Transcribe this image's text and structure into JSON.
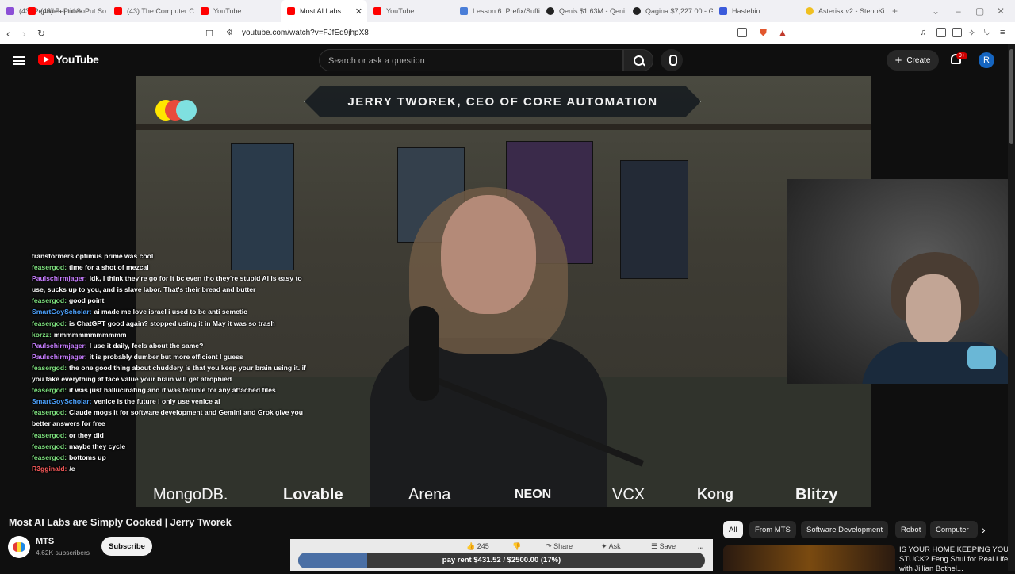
{
  "browser": {
    "tabs": [
      {
        "label": "(43) Peptides Put So...",
        "icon": "tab-favicon",
        "active": false
      },
      {
        "label": "(43) The Computer C...",
        "icon": "youtube-icon",
        "active": false
      },
      {
        "label": "YouTube",
        "icon": "youtube-icon",
        "active": false
      },
      {
        "label": "Most AI Labs",
        "icon": "youtube-icon",
        "active": true
      },
      {
        "label": "YouTube",
        "icon": "youtube-icon",
        "active": false
      },
      {
        "label": "Lesson 6: Prefix/Suffi...",
        "icon": "doc-icon",
        "active": false
      },
      {
        "label": "Qenis $1.63M - Qeni...",
        "icon": "github-icon",
        "active": false
      },
      {
        "label": "Qagina $7,227.00 - G...",
        "icon": "github-icon",
        "active": false
      },
      {
        "label": "Hastebin",
        "icon": "hastebin-icon",
        "active": false
      },
      {
        "label": "Asterisk v2 - StenoKi...",
        "icon": "asterisk-icon",
        "active": false
      }
    ],
    "url": "youtube.com/watch?v=FJfEq9jhpX8"
  },
  "youtube": {
    "logo_text": "YouTube",
    "search_placeholder": "Search or ask a question",
    "create_label": "Create",
    "notifications_badge": "9+",
    "account_initial": "R"
  },
  "video": {
    "overlay_title": "JERRY TWOREK, CEO OF CORE AUTOMATION",
    "sponsors": [
      "MongoDB.",
      "Lovable",
      "Arena",
      "NEON",
      "VCX",
      "Kong",
      "Blitzy"
    ]
  },
  "chat": [
    {
      "user": "",
      "text": "transformers optimus prime was cool",
      "color": "#ffffff"
    },
    {
      "user": "feasergod:",
      "text": "time for a shot of mezcal",
      "color": "#7ee07e"
    },
    {
      "user": "Paulschirmjager:",
      "text": "idk, I think they're go for it bc even tho they're stupid AI is easy to use, sucks up to you, and is slave labor. That's their bread and butter",
      "color": "#c77dff"
    },
    {
      "user": "feasergod:",
      "text": "good point",
      "color": "#7ee07e"
    },
    {
      "user": "SmartGoyScholar:",
      "text": "ai made me love israel i used to be anti semetic",
      "color": "#4da3ff"
    },
    {
      "user": "feasergod:",
      "text": "is ChatGPT good again? stopped using it in May it was so trash",
      "color": "#7ee07e"
    },
    {
      "user": "korzz:",
      "text": "mmmmmmmmmmmm",
      "color": "#7ee07e"
    },
    {
      "user": "Paulschirmjager:",
      "text": "I use it daily, feels about the same?",
      "color": "#c77dff"
    },
    {
      "user": "Paulschirmjager:",
      "text": "it is probably dumber but more efficient I guess",
      "color": "#c77dff"
    },
    {
      "user": "feasergod:",
      "text": "the one good thing about chuddery is that you keep your brain using it. if you take everything at face value your brain will get atrophied",
      "color": "#7ee07e"
    },
    {
      "user": "feasergod:",
      "text": "it was just hallucinating and it was terrible for any attached files",
      "color": "#7ee07e"
    },
    {
      "user": "SmartGoyScholar:",
      "text": "venice is the future i only use venice ai",
      "color": "#4da3ff"
    },
    {
      "user": "feasergod:",
      "text": "Claude mogs it for software development and Gemini and Grok give you better answers for free",
      "color": "#7ee07e"
    },
    {
      "user": "feasergod:",
      "text": "or they did",
      "color": "#7ee07e"
    },
    {
      "user": "feasergod:",
      "text": "maybe they cycle",
      "color": "#7ee07e"
    },
    {
      "user": "feasergod:",
      "text": "bottoms up",
      "color": "#7ee07e"
    },
    {
      "user": "R3gginald:",
      "text": "/e",
      "color": "#ff5c5c"
    }
  ],
  "below": {
    "title": "Most AI Labs are Simply Cooked | Jerry Tworek",
    "channel_name": "MTS",
    "subscribers": "4.62K subscribers",
    "subscribe_label": "Subscribe",
    "like_count": "245",
    "share_label": "Share",
    "ask_label": "Ask",
    "save_label": "Save",
    "more_label": "...",
    "progress_text": "pay rent $431.52 / $2500.00 (17%)",
    "progress_fraction": 0.17,
    "chips": [
      "All",
      "From MTS",
      "Software Development",
      "Robot",
      "Computer"
    ],
    "rec_title": "IS YOUR HOME KEEPING YOU STUCK? Feng Shui for Real Life with Jillian Bothel..."
  }
}
